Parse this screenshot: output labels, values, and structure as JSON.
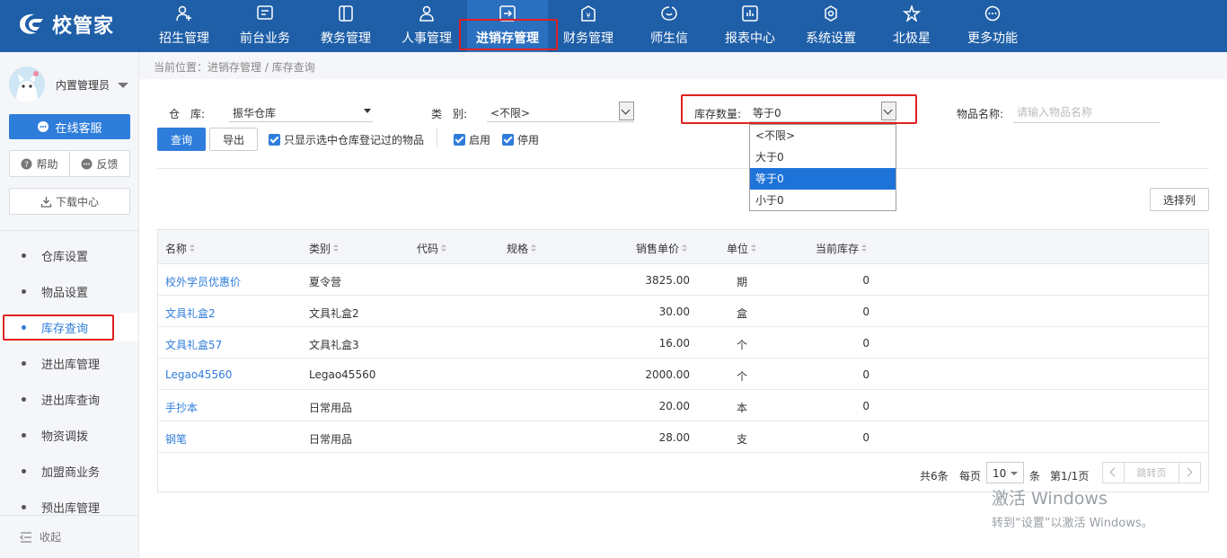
{
  "app": {
    "logo_text": "校管家"
  },
  "nav": [
    {
      "label": "招生管理",
      "icon": "user-plus-icon"
    },
    {
      "label": "前台业务",
      "icon": "monitor-icon"
    },
    {
      "label": "教务管理",
      "icon": "book-icon"
    },
    {
      "label": "人事管理",
      "icon": "person-icon"
    },
    {
      "label": "进销存管理",
      "icon": "export-box-icon"
    },
    {
      "label": "财务管理",
      "icon": "yuan-shield-icon"
    },
    {
      "label": "师生信",
      "icon": "chat-bubble-icon"
    },
    {
      "label": "报表中心",
      "icon": "chart-box-icon"
    },
    {
      "label": "系统设置",
      "icon": "gear-icon"
    },
    {
      "label": "北极星",
      "icon": "star-icon"
    },
    {
      "label": "更多功能",
      "icon": "more-dots-icon"
    }
  ],
  "sidebar": {
    "user_name": "内置管理员",
    "service_label": "在线客服",
    "help_label": "帮助",
    "feedback_label": "反馈",
    "download_label": "下载中心",
    "menu": [
      {
        "label": "仓库设置"
      },
      {
        "label": "物品设置"
      },
      {
        "label": "库存查询"
      },
      {
        "label": "进出库管理"
      },
      {
        "label": "进出库查询"
      },
      {
        "label": "物资调拨"
      },
      {
        "label": "加盟商业务"
      },
      {
        "label": "预出库管理"
      }
    ],
    "collapse_label": "收起"
  },
  "breadcrumb": "当前位置：进销存管理 / 库存查询",
  "filters": {
    "warehouse_label": "仓　库:",
    "warehouse_value": "振华仓库",
    "category_label": "类　别:",
    "category_value": "<不限>",
    "qty_label": "库存数量:",
    "qty_value": "等于0",
    "qty_options": [
      "<不限>",
      "大于0",
      "等于0",
      "小于0"
    ],
    "name_label": "物品名称:",
    "name_placeholder": "请输入物品名称"
  },
  "actions": {
    "query_label": "查询",
    "export_label": "导出",
    "only_registered_label": "只显示选中仓库登记过的物品",
    "enabled_label": "启用",
    "disabled_label": "停用",
    "choose_columns_label": "选择列"
  },
  "table": {
    "headers": [
      "名称",
      "类别",
      "代码",
      "规格",
      "销售单价",
      "单位",
      "当前库存"
    ],
    "rows": [
      {
        "name": "校外学员优惠价",
        "category": "夏令营",
        "code": "",
        "spec": "",
        "price": "3825.00",
        "unit": "期",
        "stock": "0"
      },
      {
        "name": "文具礼盒2",
        "category": "文具礼盒2",
        "code": "",
        "spec": "",
        "price": "30.00",
        "unit": "盒",
        "stock": "0"
      },
      {
        "name": "文具礼盒57",
        "category": "文具礼盒3",
        "code": "",
        "spec": "",
        "price": "16.00",
        "unit": "个",
        "stock": "0"
      },
      {
        "name": "Legao45560",
        "category": "Legao45560",
        "code": "",
        "spec": "",
        "price": "2000.00",
        "unit": "个",
        "stock": "0"
      },
      {
        "name": "手抄本",
        "category": "日常用品",
        "code": "",
        "spec": "",
        "price": "20.00",
        "unit": "本",
        "stock": "0"
      },
      {
        "name": "钢笔",
        "category": "日常用品",
        "code": "",
        "spec": "",
        "price": "28.00",
        "unit": "支",
        "stock": "0"
      }
    ]
  },
  "pager": {
    "total": "共6条",
    "per_page_label": "每页",
    "per_page_value": "10",
    "per_page_unit": "条",
    "page_info": "第1/1页",
    "jump_label": "跳转页"
  },
  "watermark": {
    "line1": "激活 Windows",
    "line2": "转到“设置”以激活 Windows。"
  },
  "colors": {
    "header": "#1f5fa8",
    "accent": "#2f7ddb",
    "highlight": "#e02020"
  }
}
